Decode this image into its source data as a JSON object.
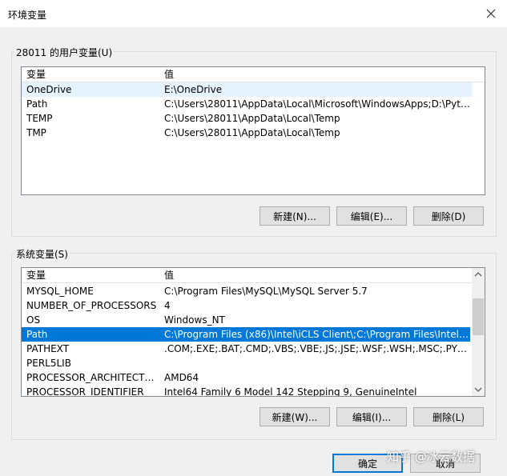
{
  "window": {
    "title": "环境变量",
    "close_icon": "close-icon"
  },
  "user_vars": {
    "legend": "28011 的用户变量(U)",
    "columns": [
      "变量",
      "值"
    ],
    "rows": [
      {
        "name": "OneDrive",
        "value": "E:\\OneDrive"
      },
      {
        "name": "Path",
        "value": "C:\\Users\\28011\\AppData\\Local\\Microsoft\\WindowsApps;D:\\Pytho..."
      },
      {
        "name": "TEMP",
        "value": "C:\\Users\\28011\\AppData\\Local\\Temp"
      },
      {
        "name": "TMP",
        "value": "C:\\Users\\28011\\AppData\\Local\\Temp"
      }
    ],
    "buttons": {
      "new": "新建(N)...",
      "edit": "编辑(E)...",
      "delete": "删除(D)"
    }
  },
  "system_vars": {
    "legend": "系统变量(S)",
    "columns": [
      "变量",
      "值"
    ],
    "rows": [
      {
        "name": "MYSQL_HOME",
        "value": "C:\\Program Files\\MySQL\\MySQL Server 5.7"
      },
      {
        "name": "NUMBER_OF_PROCESSORS",
        "value": "4"
      },
      {
        "name": "OS",
        "value": "Windows_NT"
      },
      {
        "name": "Path",
        "value": "C:\\Program Files (x86)\\Intel\\iCLS Client\\;C:\\Program Files\\Intel\\iCL..."
      },
      {
        "name": "PATHEXT",
        "value": ".COM;.EXE;.BAT;.CMD;.VBS;.VBE;.JS;.JSE;.WSF;.WSH;.MSC;.PY;.PYW"
      },
      {
        "name": "PERL5LIB",
        "value": ""
      },
      {
        "name": "PROCESSOR_ARCHITECTURE",
        "value": "AMD64"
      },
      {
        "name": "PROCESSOR_IDENTIFIER",
        "value": "Intel64 Family 6 Model 142 Stepping 9, GenuineIntel"
      }
    ],
    "buttons": {
      "new": "新建(W)...",
      "edit": "编辑(I)...",
      "delete": "删除(L)"
    }
  },
  "footer": {
    "ok": "确定",
    "cancel": "取消"
  },
  "watermark": "知乎 @冰云数据",
  "colors": {
    "selection": "#0078d7",
    "hover": "#e5f3ff",
    "dialog_bg": "#f0f0f0"
  }
}
